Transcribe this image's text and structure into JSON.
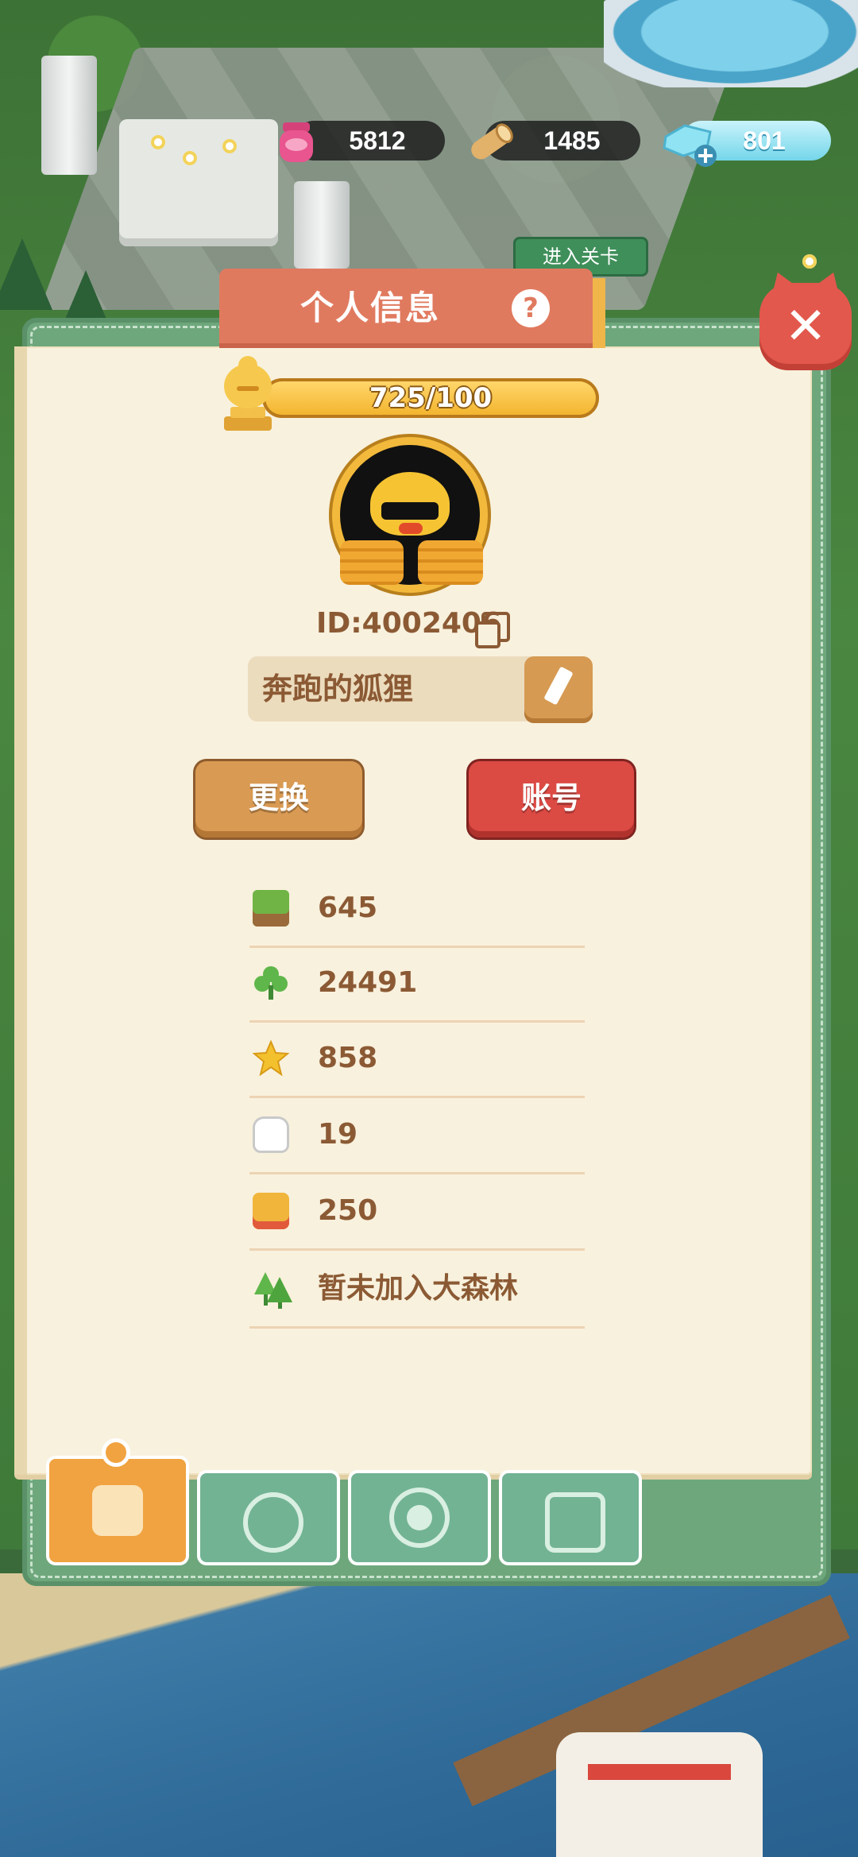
{
  "resources": [
    {
      "icon": "jam-jar-icon",
      "value": "5812"
    },
    {
      "icon": "wood-log-icon",
      "value": "1485"
    },
    {
      "icon": "diamond-plus-icon",
      "value": "801"
    }
  ],
  "background": {
    "sign_label": "进入关卡"
  },
  "panel": {
    "title": "个人信息",
    "help_label": "?",
    "close_label": "✕"
  },
  "profile": {
    "level_progress_text": "725/100",
    "level_progress_fraction": 1.0,
    "id_text": "ID:4002406",
    "nickname": "奔跑的狐狸",
    "change_label": "更换",
    "account_label": "账号"
  },
  "stats": [
    {
      "icon": "grass-block-icon",
      "value": "645"
    },
    {
      "icon": "clover-icon",
      "value": "24491"
    },
    {
      "icon": "star-icon",
      "value": "858"
    },
    {
      "icon": "thumbs-up-icon",
      "value": "19"
    },
    {
      "icon": "bus-icon",
      "value": "250"
    },
    {
      "icon": "forest-icon",
      "value": "暂未加入大森林"
    }
  ],
  "tabs": [
    {
      "name": "profile-card-tab",
      "active": true
    },
    {
      "name": "badge-tab",
      "active": false
    },
    {
      "name": "settings-gear-tab",
      "active": false
    },
    {
      "name": "album-tab",
      "active": false
    }
  ],
  "colors": {
    "panel_green": "#6ea77c",
    "paper": "#f8f1dd",
    "title_tab": "#e07a5f",
    "text_brown": "#8b5a34",
    "account_red": "#dc4a44",
    "change_orange": "#d99a53"
  }
}
